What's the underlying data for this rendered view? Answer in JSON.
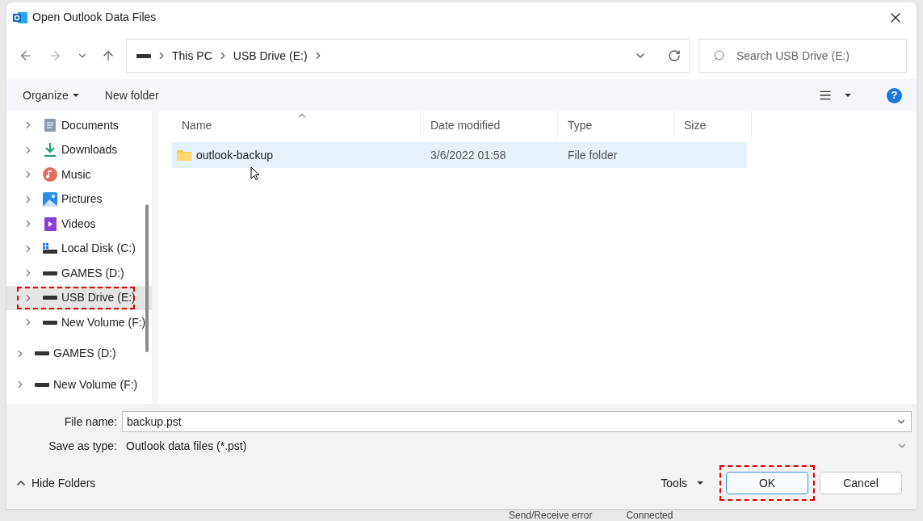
{
  "window": {
    "title": "Open Outlook Data Files"
  },
  "address_bar": {
    "crumbs": [
      "This PC",
      "USB Drive (E:)"
    ]
  },
  "search": {
    "placeholder": "Search USB Drive (E:)"
  },
  "command_bar": {
    "organize": "Organize",
    "new_folder": "New folder",
    "help": "?"
  },
  "sidebar": {
    "nested_items": [
      {
        "label": "Documents",
        "kind": "documents",
        "selected": false,
        "highlighted": false
      },
      {
        "label": "Downloads",
        "kind": "downloads",
        "selected": false,
        "highlighted": false
      },
      {
        "label": "Music",
        "kind": "music",
        "selected": false,
        "highlighted": false
      },
      {
        "label": "Pictures",
        "kind": "pictures",
        "selected": false,
        "highlighted": false
      },
      {
        "label": "Videos",
        "kind": "videos",
        "selected": false,
        "highlighted": false
      },
      {
        "label": "Local Disk (C:)",
        "kind": "system-drive",
        "selected": false,
        "highlighted": false
      },
      {
        "label": "GAMES (D:)",
        "kind": "drive",
        "selected": false,
        "highlighted": false
      },
      {
        "label": "USB Drive (E:)",
        "kind": "drive",
        "selected": true,
        "highlighted": true
      },
      {
        "label": "New Volume (F:)",
        "kind": "drive",
        "selected": false,
        "highlighted": false
      }
    ],
    "items": [
      {
        "label": "GAMES (D:)",
        "kind": "drive",
        "selected": false,
        "highlighted": false
      },
      {
        "label": "New Volume (F:)",
        "kind": "drive",
        "selected": false,
        "highlighted": false
      }
    ]
  },
  "table": {
    "columns": [
      "Name",
      "Date modified",
      "Type",
      "Size"
    ],
    "rows": [
      {
        "name": "outlook-backup",
        "date": "3/6/2022 01:58",
        "type": "File folder",
        "selected": true
      }
    ]
  },
  "file_name": {
    "label": "File name:",
    "value": "backup.pst"
  },
  "save_as_type": {
    "label": "Save as type:",
    "value": "Outlook data files (*.pst)"
  },
  "hide_folders": "Hide Folders",
  "tools": "Tools",
  "buttons": [
    {
      "label": "OK",
      "highlighted": true
    },
    {
      "label": "Cancel",
      "highlighted": false
    }
  ],
  "background_status": [
    "Send/Receive error",
    "Connected"
  ]
}
